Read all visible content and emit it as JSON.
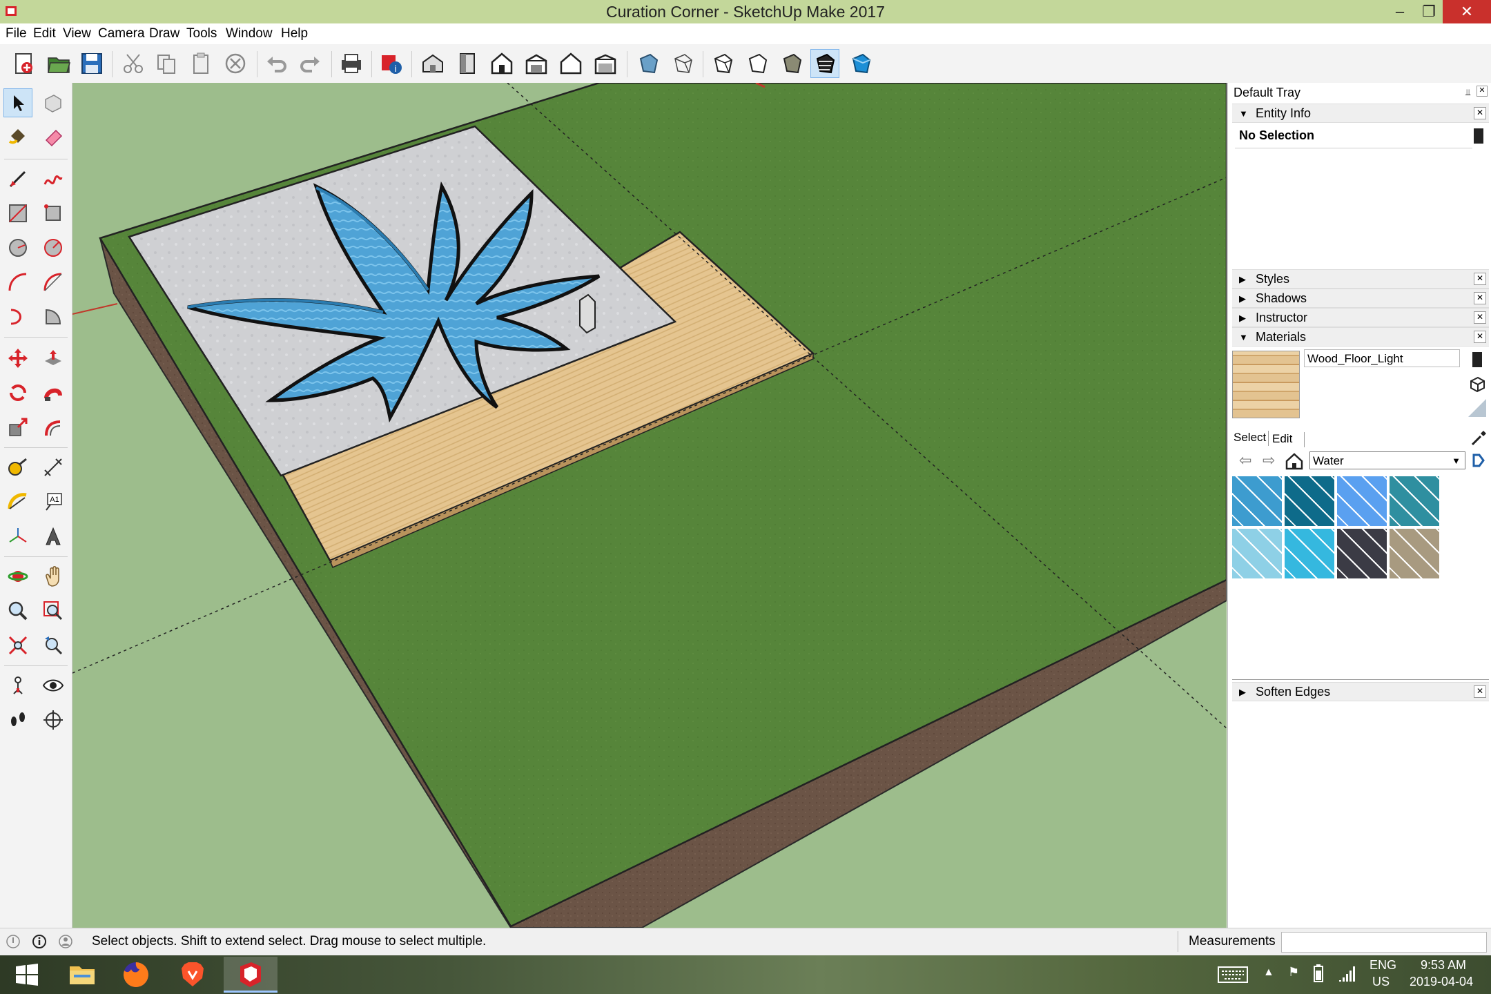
{
  "window": {
    "title": "Curation Corner - SketchUp Make 2017",
    "minimize": "–",
    "restore": "❐",
    "close": "✕"
  },
  "menu": [
    "File",
    "Edit",
    "View",
    "Camera",
    "Draw",
    "Tools",
    "Window",
    "Help"
  ],
  "tray": {
    "title": "Default Tray",
    "entity_info": {
      "label": "Entity Info",
      "selection": "No Selection"
    },
    "styles": "Styles",
    "shadows": "Shadows",
    "instructor": "Instructor",
    "materials": {
      "label": "Materials",
      "current_name": "Wood_Floor_Light",
      "tab_select": "Select",
      "tab_edit": "Edit",
      "library": "Water",
      "swatches": [
        {
          "name": "water-swatch-1",
          "color": "#3d9ccf"
        },
        {
          "name": "water-swatch-2",
          "color": "#0e6b8a"
        },
        {
          "name": "water-swatch-3",
          "color": "#5aa0f0"
        },
        {
          "name": "water-swatch-4",
          "color": "#2f8fa0"
        },
        {
          "name": "water-swatch-5",
          "color": "#8ed0e6"
        },
        {
          "name": "water-swatch-6",
          "color": "#35b8df"
        },
        {
          "name": "water-swatch-7",
          "color": "#3b3b45"
        },
        {
          "name": "water-swatch-8",
          "color": "#a89a80"
        }
      ]
    },
    "soften_edges": "Soften Edges"
  },
  "status": {
    "message": "Select objects. Shift to extend select. Drag mouse to select multiple.",
    "measurements_label": "Measurements"
  },
  "taskbar": {
    "lang": "ENG",
    "region": "US",
    "time": "9:53 AM",
    "date": "2019-04-04"
  }
}
